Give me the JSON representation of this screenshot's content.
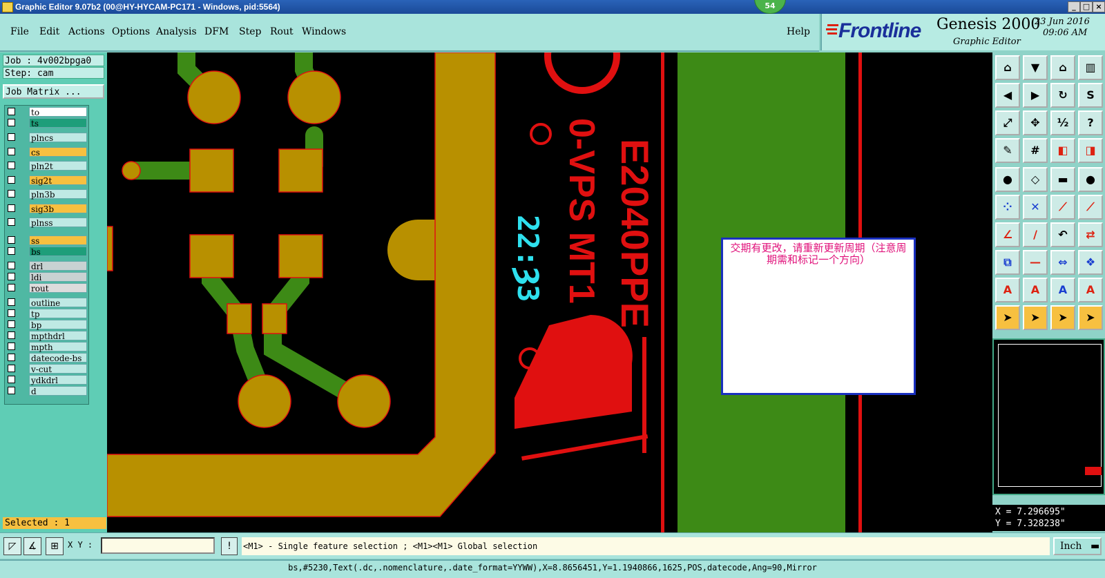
{
  "titlebar": {
    "title": "Graphic Editor 9.07b2 (00@HY-HYCAM-PC171 - Windows, pid:5564)",
    "badge": "54",
    "minimize": "_",
    "maximize": "□",
    "close": "×"
  },
  "menu": {
    "items": [
      "File",
      "Edit",
      "Actions",
      "Options",
      "Analysis",
      "DFM",
      "Step",
      "Rout",
      "Windows"
    ],
    "help": "Help"
  },
  "brand": {
    "logo": "Frontline",
    "product": "Genesis 2000",
    "subtitle": "Graphic Editor",
    "date": "23 Jun 2016",
    "time": "09:06 AM"
  },
  "job": {
    "job": "Job : 4v002bpga0",
    "step": "Step: cam",
    "matrix_button": "Job Matrix ..."
  },
  "layers": [
    {
      "name": "to",
      "color": "#ffffff"
    },
    {
      "name": "ts",
      "color": "#1e9e7a"
    },
    {
      "name": "plncs",
      "color": "#bfe9e4"
    },
    {
      "name": "cs",
      "color": "#f7c040"
    },
    {
      "name": "pln2t",
      "color": "#bfe9e4"
    },
    {
      "name": "sig2t",
      "color": "#f7c040"
    },
    {
      "name": "pln3b",
      "color": "#bfe9e4"
    },
    {
      "name": "sig3b",
      "color": "#f7c040"
    },
    {
      "name": "plnss",
      "color": "#bfe9e4"
    },
    {
      "name": "ss",
      "color": "#f7c040"
    },
    {
      "name": "bs",
      "color": "#1e9e7a"
    },
    {
      "name": "drl",
      "color": "#c8d2d2"
    },
    {
      "name": "ldi",
      "color": "#c8d2d2"
    },
    {
      "name": "rout",
      "color": "#dcdcdc"
    },
    {
      "name": "outline",
      "color": "#bfe9e4"
    },
    {
      "name": "tp",
      "color": "#bfe9e4"
    },
    {
      "name": "bp",
      "color": "#bfe9e4"
    },
    {
      "name": "mpthdrl",
      "color": "#bfe9e4"
    },
    {
      "name": "mpth",
      "color": "#bfe9e4"
    },
    {
      "name": "datecode-bs",
      "color": "#bfe9e4"
    },
    {
      "name": "v-cut",
      "color": "#bfe9e4"
    },
    {
      "name": "ydkdrl",
      "color": "#bfe9e4"
    },
    {
      "name": "d",
      "color": "#bfe9e4"
    }
  ],
  "selected": "Selected : 1",
  "canvas": {
    "text_red_1": "E2040PPE",
    "text_red_2": "0-VPS MT1",
    "text_cyan": "22:Ȝ3",
    "logo_r": "R"
  },
  "dialog": {
    "message": "交期有更改，请重新更新周期（注意周期需和标记一个方向）"
  },
  "coords": {
    "x": "X = 7.296695\"",
    "y": "Y = 7.328238\""
  },
  "bottom": {
    "xy_label": "X Y :",
    "xy_value": "",
    "hint": "<M1> - Single feature selection ; <M1><M1> Global selection",
    "units": "Inch"
  },
  "status": "bs,#5230,Text(.dc,.nomenclature,.date_format=YYWW),X=8.8656451,Y=1.1940866,1625,POS,datecode,Ang=90,Mirror"
}
